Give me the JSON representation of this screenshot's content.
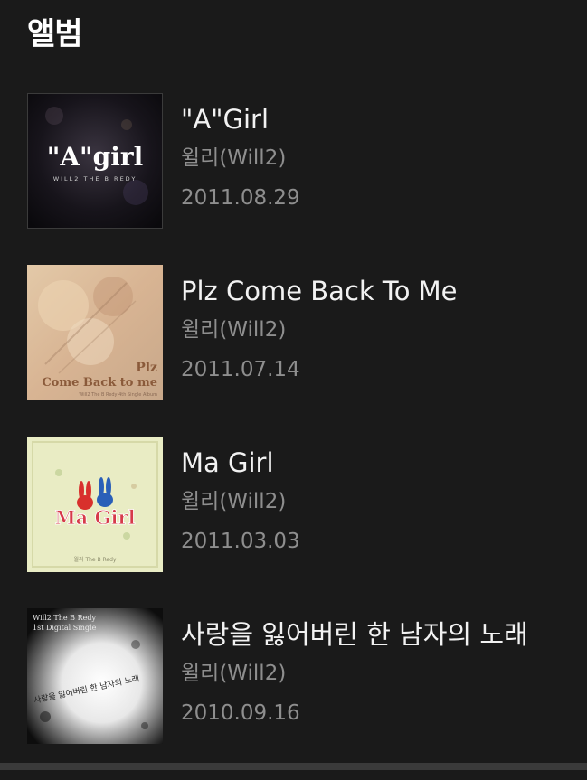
{
  "section": {
    "title": "앨범"
  },
  "albums": [
    {
      "title": "\"A\"Girl",
      "artist": "윌리(Will2)",
      "date": "2011.08.29",
      "cover_text": "\"A\"girl",
      "cover_subtext": "WILL2 THE B REDY"
    },
    {
      "title": "Plz Come Back To Me",
      "artist": "윌리(Will2)",
      "date": "2011.07.14",
      "cover_text": "Plz",
      "cover_text2": "Come Back to me",
      "cover_subtext": "Will2 The B Redy 4th Single Album"
    },
    {
      "title": "Ma Girl",
      "artist": "윌리(Will2)",
      "date": "2011.03.03",
      "cover_text": "Ma Girl",
      "cover_subtext": "윌리 The B Redy"
    },
    {
      "title": "사랑을 잃어버린 한 남자의 노래",
      "artist": "윌리(Will2)",
      "date": "2010.09.16",
      "cover_text": "Will2 The B Redy",
      "cover_text2": "1st Digital Single",
      "cover_subtext": "사랑을 잃어버린 한 남자의 노래"
    }
  ],
  "colors": {
    "background": "#1a1a1a",
    "title": "#f2f2f2",
    "secondary": "#8e8e8e"
  }
}
